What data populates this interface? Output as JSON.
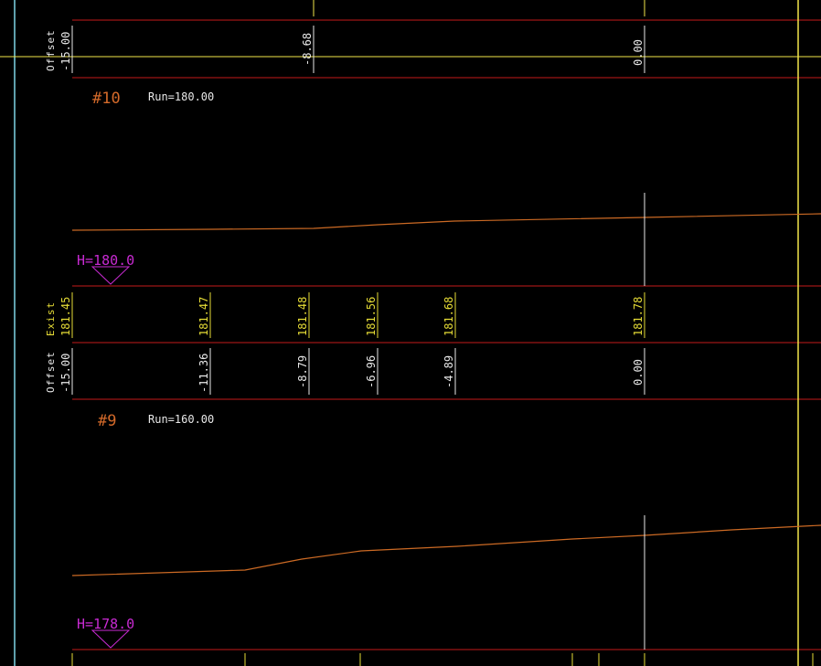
{
  "colors": {
    "background": "#000000",
    "grid_red": "#c41a1a",
    "crosshair_yellow": "#f2e64a",
    "cursor_cyan": "#7fd6e6",
    "profile_orange": "#cc6a24",
    "white_text": "#e8e8e8",
    "exist_yellow": "#e6dc36",
    "datum_magenta": "#c82ad2",
    "section_orange": "#d46a2a"
  },
  "top_band": {
    "row_label": "Offset",
    "offsets": [
      {
        "value": "-15.00"
      },
      {
        "value": "-8.68"
      },
      {
        "value": "0.00"
      }
    ]
  },
  "section_10": {
    "title": "#10",
    "run": "Run=180.00",
    "datum": "H=180.0",
    "profile_points": [
      {
        "offset": -15.0,
        "elev": 181.45
      },
      {
        "offset": -11.36,
        "elev": 181.47
      },
      {
        "offset": -8.79,
        "elev": 181.48
      },
      {
        "offset": -6.96,
        "elev": 181.56
      },
      {
        "offset": -4.89,
        "elev": 181.68
      },
      {
        "offset": 0.0,
        "elev": 181.78
      }
    ],
    "exist_label": "Exist",
    "exist_values": [
      "181.45",
      "181.47",
      "181.48",
      "181.56",
      "181.68",
      "181.78"
    ],
    "offset_label": "Offset",
    "offset_values": [
      "-15.00",
      "-11.36",
      "-8.79",
      "-6.96",
      "-4.89",
      "0.00"
    ]
  },
  "section_9": {
    "title": "#9",
    "run": "Run=160.00",
    "datum": "H=178.0"
  }
}
